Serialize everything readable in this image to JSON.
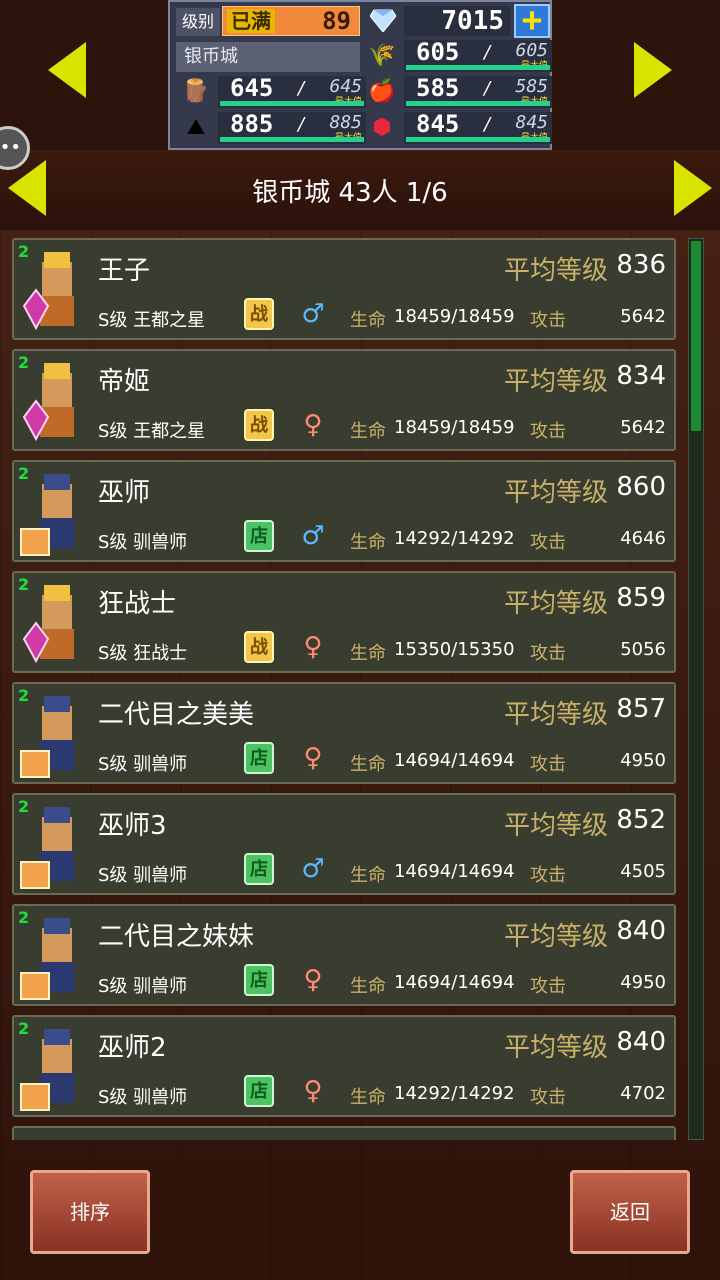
{
  "top_panel": {
    "level_label": "级别",
    "level_status": "已满",
    "level_value": "89",
    "gems": "7015",
    "town": "银币城",
    "max_label": "最大值",
    "resources": [
      {
        "icon": "wood-icon",
        "current": "645",
        "max": "645"
      },
      {
        "icon": "grass-icon",
        "current": "605",
        "max": "605"
      },
      {
        "icon": "food-icon",
        "current": "585",
        "max": "585"
      },
      {
        "icon": "ore-icon",
        "current": "885",
        "max": "885"
      },
      {
        "icon": "ruby-icon",
        "current": "845",
        "max": "845"
      }
    ]
  },
  "header": {
    "title": "银币城  43人  1/6"
  },
  "labels": {
    "avg_level": "平均等级",
    "hp": "生命",
    "attack": "攻击"
  },
  "units": [
    {
      "name": "王子",
      "avg_level": "836",
      "class": "S级 王都之星",
      "tag": "战",
      "tag_type": "fight",
      "gender": "male",
      "hp": "18459/18459",
      "attack": "5642",
      "badge": "2"
    },
    {
      "name": "帝姬",
      "avg_level": "834",
      "class": "S级 王都之星",
      "tag": "战",
      "tag_type": "fight",
      "gender": "female",
      "hp": "18459/18459",
      "attack": "5642",
      "badge": "2"
    },
    {
      "name": "巫师",
      "avg_level": "860",
      "class": "S级 驯兽师",
      "tag": "店",
      "tag_type": "shop",
      "gender": "male",
      "hp": "14292/14292",
      "attack": "4646",
      "badge": "2"
    },
    {
      "name": "狂战士",
      "avg_level": "859",
      "class": "S级 狂战士",
      "tag": "战",
      "tag_type": "fight",
      "gender": "female",
      "hp": "15350/15350",
      "attack": "5056",
      "badge": "2"
    },
    {
      "name": "二代目之美美",
      "avg_level": "857",
      "class": "S级 驯兽师",
      "tag": "店",
      "tag_type": "shop",
      "gender": "female",
      "hp": "14694/14694",
      "attack": "4950",
      "badge": "2"
    },
    {
      "name": "巫师3",
      "avg_level": "852",
      "class": "S级 驯兽师",
      "tag": "店",
      "tag_type": "shop",
      "gender": "male",
      "hp": "14694/14694",
      "attack": "4505",
      "badge": "2"
    },
    {
      "name": "二代目之妹妹",
      "avg_level": "840",
      "class": "S级 驯兽师",
      "tag": "店",
      "tag_type": "shop",
      "gender": "female",
      "hp": "14694/14694",
      "attack": "4950",
      "badge": "2"
    },
    {
      "name": "巫师2",
      "avg_level": "840",
      "class": "S级 驯兽师",
      "tag": "店",
      "tag_type": "shop",
      "gender": "female",
      "hp": "14292/14292",
      "attack": "4702",
      "badge": "2"
    }
  ],
  "buttons": {
    "sort": "排序",
    "back": "返回"
  },
  "colors": {
    "accent_yellow": "#d8e400",
    "level_gold": "#c9b06a",
    "hp_bar": "#23d18b"
  }
}
